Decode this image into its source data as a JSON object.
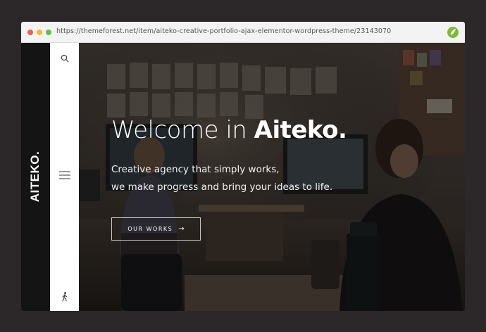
{
  "browser": {
    "url": "https://themeforest.net/item/aiteko-creative-portfolio-ajax-elementor-wordpress-theme/23143070",
    "icons": [
      "close-dot",
      "minimize-dot",
      "maximize-dot",
      "envato-leaf-icon"
    ]
  },
  "site": {
    "logo": "AITEKO.",
    "headline_regular": "Welcome in ",
    "headline_bold": "Aiteko.",
    "subtitle_line1": "Creative agency that simply works,",
    "subtitle_line2": "we make progress and bring your ideas to life.",
    "cta_label": "OUR WORKS",
    "cta_arrow": "→",
    "sidebar_icons": [
      "search-icon",
      "menu-icon",
      "walking-person-icon"
    ]
  },
  "colors": {
    "page_background": "#2c2829",
    "logo_bar": "#141414",
    "sidebar": "#ffffff",
    "hero_text": "#ffffff"
  }
}
